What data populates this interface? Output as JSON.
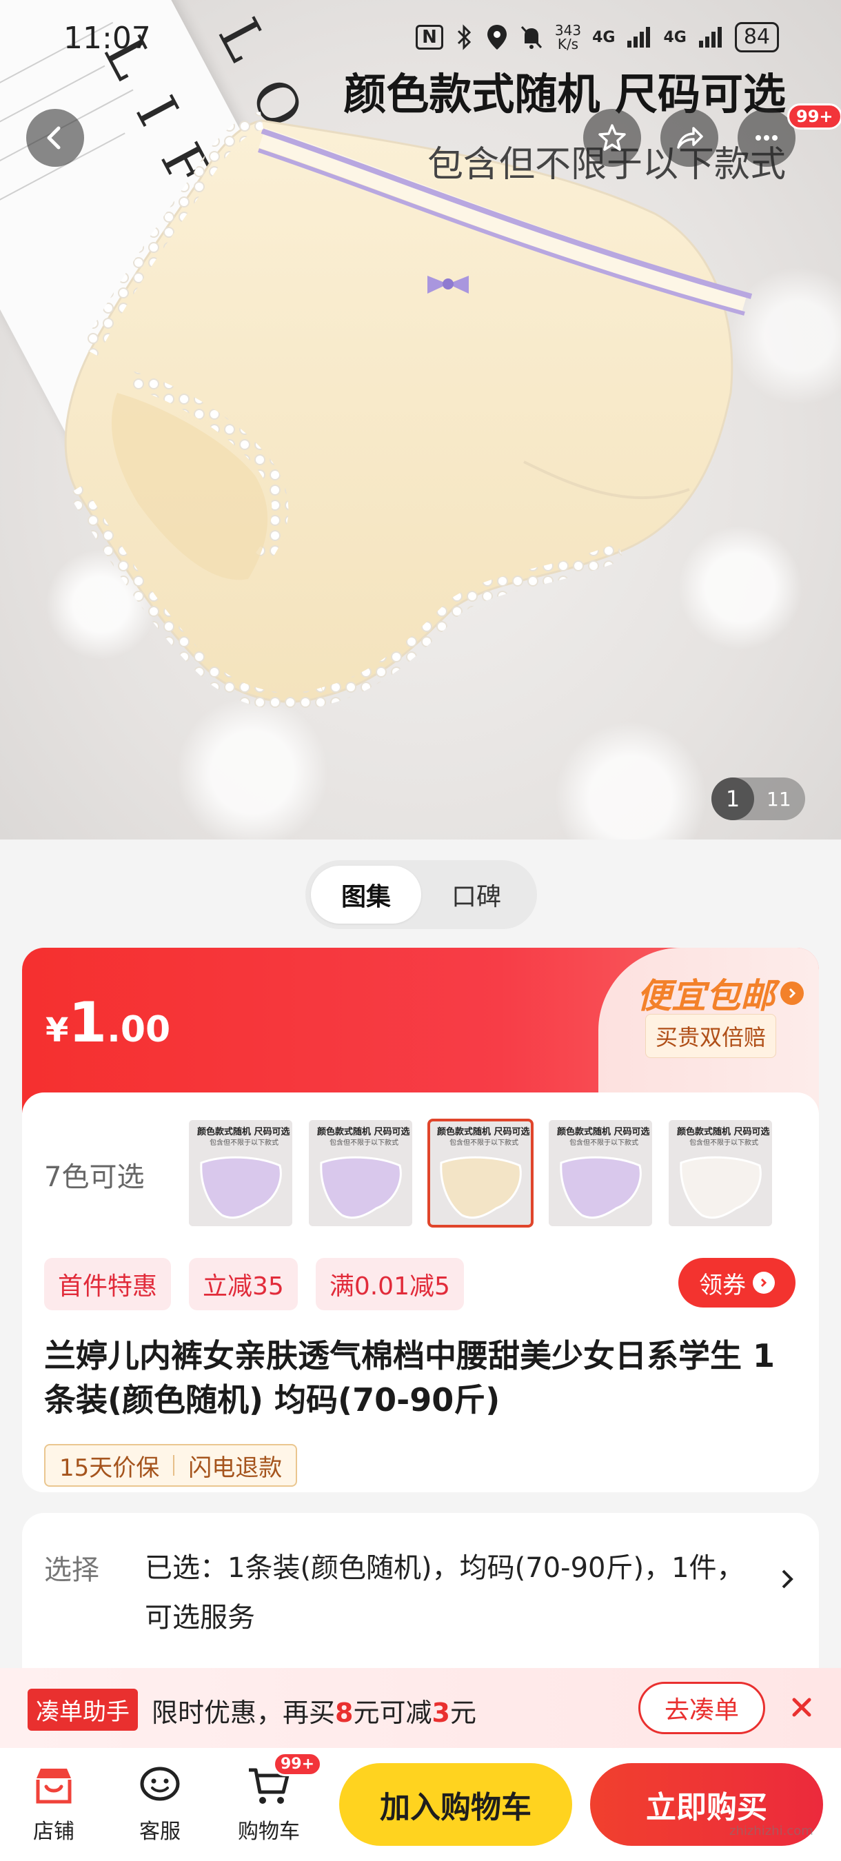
{
  "status_bar": {
    "time": "11:07",
    "nfc": "N",
    "speed_value": "343",
    "speed_unit": "K/s",
    "network_1": "4G",
    "network_2": "4G",
    "battery": "84"
  },
  "hero": {
    "banner_title": "颜色款式随机 尺码可选",
    "banner_subtitle": "包含但不限于以下款式",
    "paper_brand_line1": "S L O",
    "paper_brand_line2": "L I F",
    "more_badge": "99+",
    "page_current": "1",
    "page_total": "11"
  },
  "gallery_toggle": {
    "options": [
      "图集",
      "口碑"
    ],
    "active": "图集"
  },
  "price_card": {
    "currency": "¥",
    "price_int": "1",
    "price_dec": ".00",
    "promo_title": "便宜包邮",
    "promo_subtitle": "买贵双倍赔",
    "colors_label": "7色可选",
    "thumbnails": [
      {
        "color": "purple",
        "text1": "颜色款式随机 尺码可选",
        "text2": "包含但不限于以下款式"
      },
      {
        "color": "purple",
        "text1": "颜色款式随机 尺码可选",
        "text2": "包含但不限于以下款式"
      },
      {
        "color": "cream",
        "text1": "颜色款式随机 尺码可选",
        "text2": "包含但不限于以下款式"
      },
      {
        "color": "purple",
        "text1": "颜色款式随机 尺码可选",
        "text2": "包含但不限于以下款式"
      },
      {
        "color": "white",
        "text1": "颜色款式随机 尺码可选",
        "text2": "包含但不限于以下款式"
      }
    ],
    "selected_thumb_index": 2,
    "tags": [
      "首件特惠",
      "立减35",
      "满0.01减5"
    ],
    "coupon_label": "领券",
    "product_title": "兰婷儿内裤女亲肤透气棉档中腰甜美少女日系学生 1条装(颜色随机) 均码(70-90斤)",
    "service_tags": [
      "15天价保",
      "闪电退款"
    ]
  },
  "select_card": {
    "label": "选择",
    "value": "已选：1条装(颜色随机)，均码(70-90斤)，1件，可选服务"
  },
  "helper": {
    "tag": "凑单助手",
    "text_prefix": "限时优惠，再买",
    "amount1": "8",
    "text_mid": "元可减",
    "amount2": "3",
    "text_suffix": "元",
    "button": "去凑单"
  },
  "bottom_bar": {
    "shop_label": "店铺",
    "service_label": "客服",
    "cart_label": "购物车",
    "cart_badge": "99+",
    "add_to_cart": "加入购物车",
    "buy_now": "立即购买"
  },
  "watermark": "zhizhizhi.com",
  "colors": {
    "brand_red": "#f3332f",
    "cart_yellow": "#ffd31f",
    "promo_orange": "#f3812a"
  }
}
